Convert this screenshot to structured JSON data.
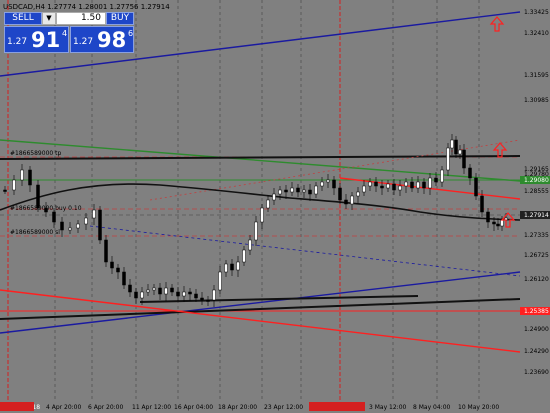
{
  "chart": {
    "title": "USDCAD,H4  1.27774 1.28001 1.27756 1.27914",
    "price_labels": [
      "1.33425",
      "1.32410",
      "1.31595",
      "1.30985",
      "1.29780",
      "1.29165",
      "1.28555",
      "1.27914",
      "1.27335",
      "1.26725",
      "1.26120",
      "1.25385",
      "1.24900",
      "1.24290",
      "1.23690"
    ],
    "price_highlights": {
      "1.29080": "#2e8b2e",
      "1.27914": "#222222",
      "1.25385": "#ff2020"
    },
    "highlight_labels": [
      "1.29080",
      "1.25385"
    ],
    "time_labels": [
      "30 Mar 2018",
      "4 Apr 20:00",
      "6 Apr 20:00",
      "11 Apr 12:00",
      "16 Apr 04:00",
      "18 Apr 20:00",
      "23 Apr 12:00",
      "2018.04.27 20:00",
      "3 May 12:00",
      "8 May 04:00",
      "10 May 20:00"
    ],
    "order_labels": [
      "#1866589000 tp",
      "#1866589000 buy 0.10",
      "#1866589000 sl"
    ]
  },
  "panel": {
    "sell_label": "SELL",
    "buy_label": "BUY",
    "volume": "1.50",
    "sell_prefix": "1.27",
    "sell_big": "91",
    "sell_sup": "4",
    "buy_prefix": "1.27",
    "buy_big": "98",
    "buy_sup": "6"
  },
  "colors": {
    "background": "#808080",
    "bull": "#ffffff",
    "bear": "#000000"
  }
}
